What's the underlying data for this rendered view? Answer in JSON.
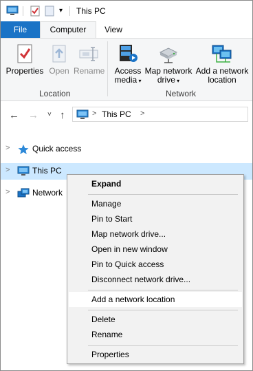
{
  "window": {
    "title": "This PC"
  },
  "ribbon": {
    "tabs": [
      {
        "label": "File"
      },
      {
        "label": "Computer"
      },
      {
        "label": "View"
      }
    ],
    "location": {
      "buttons": [
        {
          "label": "Properties"
        },
        {
          "label": "Open"
        },
        {
          "label": "Rename"
        }
      ],
      "group_label": "Location"
    },
    "network": {
      "buttons": [
        {
          "line1": "Access",
          "line2": "media"
        },
        {
          "line1": "Map network",
          "line2": "drive"
        },
        {
          "line1": "Add a network",
          "line2": "location"
        }
      ],
      "group_label": "Network"
    }
  },
  "address": {
    "path": "This PC",
    "separator": ">"
  },
  "tree": {
    "items": [
      {
        "label": "Quick access"
      },
      {
        "label": "This PC"
      },
      {
        "label": "Network"
      }
    ]
  },
  "context_menu": {
    "items": [
      {
        "label": "Expand"
      },
      {
        "label": "Manage"
      },
      {
        "label": "Pin to Start"
      },
      {
        "label": "Map network drive..."
      },
      {
        "label": "Open in new window"
      },
      {
        "label": "Pin to Quick access"
      },
      {
        "label": "Disconnect network drive..."
      },
      {
        "label": "Add a network location"
      },
      {
        "label": "Delete"
      },
      {
        "label": "Rename"
      },
      {
        "label": "Properties"
      }
    ]
  },
  "colors": {
    "file_tab": "#1a73c6",
    "selection": "#cce8ff",
    "ribbon_bg": "#f5f6f7"
  }
}
